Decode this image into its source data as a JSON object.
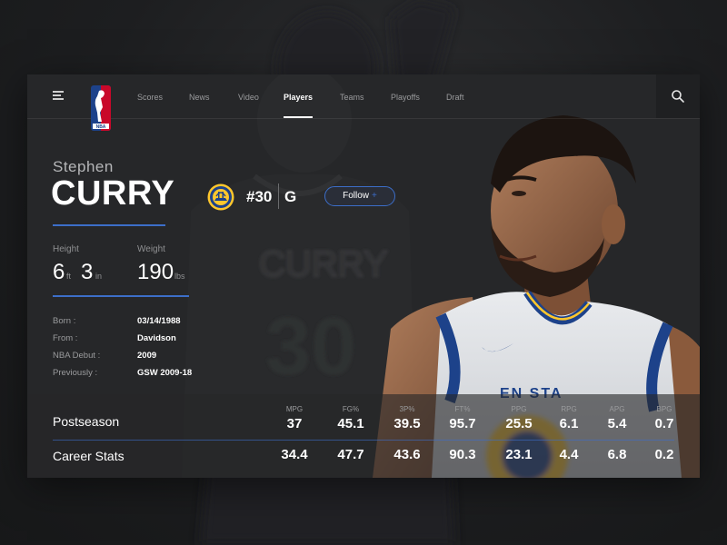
{
  "nav": {
    "items": [
      {
        "label": "Scores"
      },
      {
        "label": "News"
      },
      {
        "label": "Video"
      },
      {
        "label": "Players",
        "active": true
      },
      {
        "label": "Teams"
      },
      {
        "label": "Playoffs"
      },
      {
        "label": "Draft"
      }
    ],
    "logo_text": "NBA"
  },
  "player": {
    "first_name": "Stephen",
    "last_name": "CURRY",
    "jersey": "#30",
    "position": "G",
    "follow_label": "Follow",
    "follow_icon": "+",
    "jersey_print": "CURRY",
    "jersey_number_print": "30",
    "shirt_print": "EN STA"
  },
  "measurements": {
    "height_label": "Height",
    "height_ft": "6",
    "height_ft_unit": "ft",
    "height_in": "3",
    "height_in_unit": "in",
    "weight_label": "Weight",
    "weight_value": "190",
    "weight_unit": "lbs"
  },
  "info": [
    {
      "label": "Born :",
      "value": "03/14/1988"
    },
    {
      "label": "From :",
      "value": "Davidson"
    },
    {
      "label": "NBA Debut :",
      "value": "2009"
    },
    {
      "label": "Previously :",
      "value": "GSW 2009-18"
    }
  ],
  "stats": {
    "columns": [
      "MPG",
      "FG%",
      "3P%",
      "FT%",
      "PPG",
      "RPG",
      "APG",
      "BPG"
    ],
    "rows": [
      {
        "label": "Postseason",
        "values": [
          "37",
          "45.1",
          "39.5",
          "95.7",
          "25.5",
          "6.1",
          "5.4",
          "0.7"
        ]
      },
      {
        "label": "Career Stats",
        "values": [
          "34.4",
          "47.7",
          "43.6",
          "90.3",
          "23.1",
          "4.4",
          "6.8",
          "0.2"
        ]
      }
    ]
  },
  "colors": {
    "accent_blue": "#3c6ec9",
    "warriors_blue": "#1d428a",
    "warriors_gold": "#ffc72c",
    "nba_red": "#c9082a"
  },
  "icons": [
    "menu-icon",
    "nba-logo",
    "search-icon",
    "warriors-badge-icon"
  ]
}
